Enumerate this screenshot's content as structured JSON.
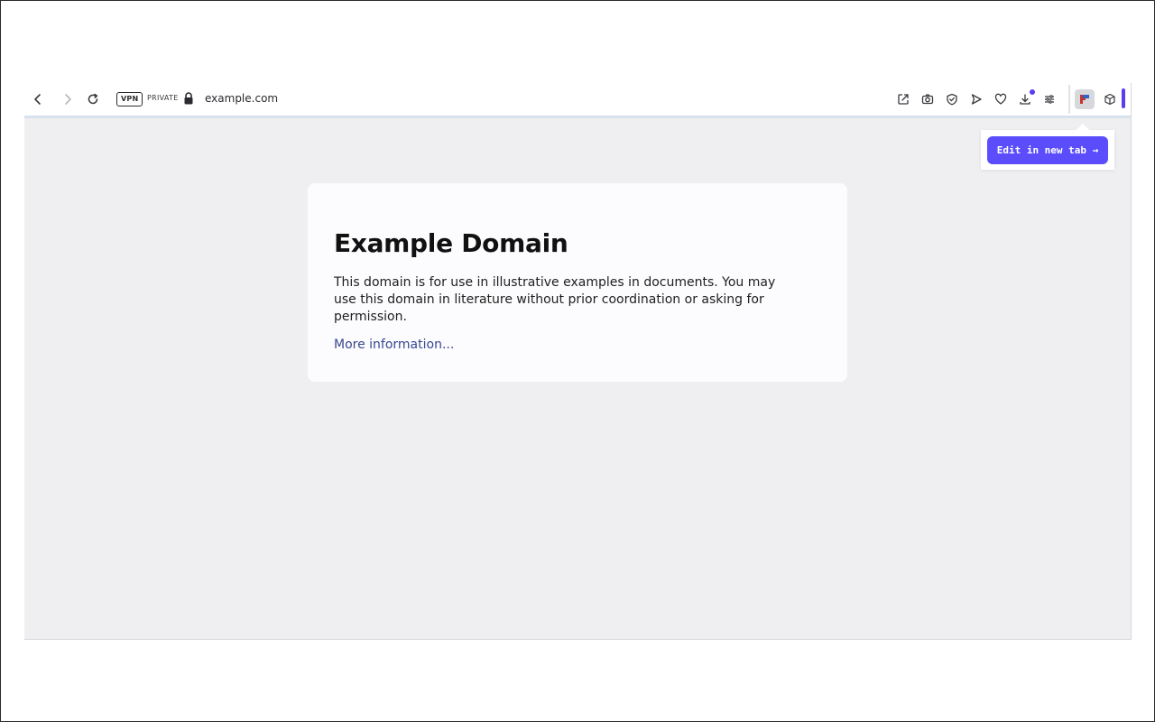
{
  "toolbar": {
    "vpn_label": "VPN",
    "private_label": "PRIVATE",
    "url": "example.com",
    "icons": [
      "back-icon",
      "forward-icon",
      "reload-icon",
      "lock-icon",
      "share-edit-icon",
      "camera-icon",
      "shield-icon",
      "send-icon",
      "heart-icon",
      "download-icon",
      "settings-sliders-icon",
      "extension-flag-icon",
      "cube-icon"
    ],
    "accent_color": "#5b3cf2"
  },
  "popup": {
    "button_label": "Edit in new tab →"
  },
  "page": {
    "title": "Example Domain",
    "description": "This domain is for use in illustrative examples in documents. You may use this domain in literature without prior coordination or asking for permission.",
    "link_text": "More information..."
  }
}
